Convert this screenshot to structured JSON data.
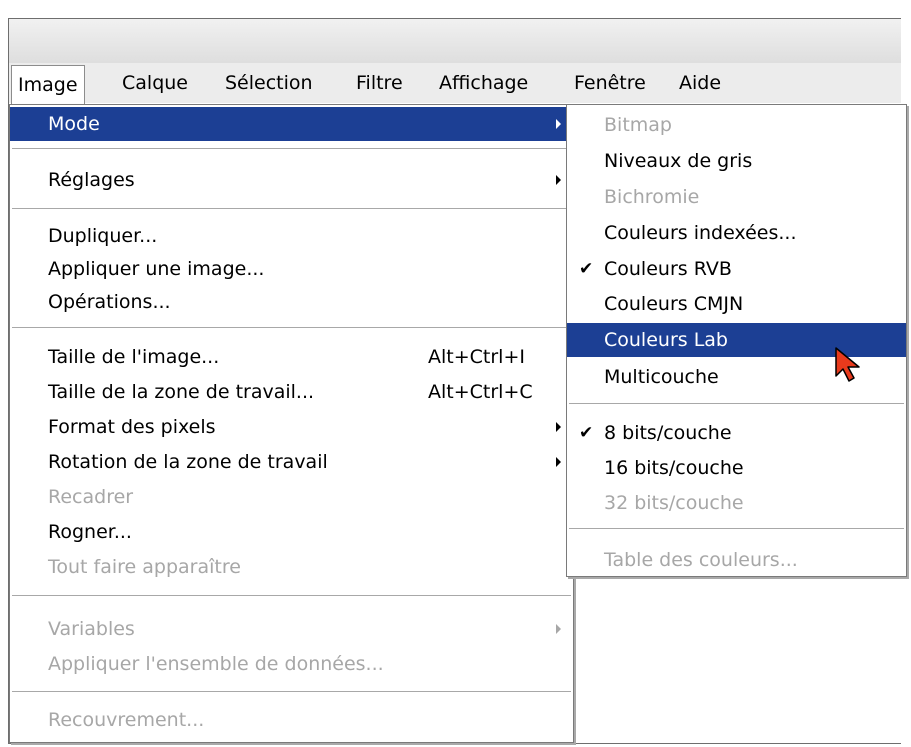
{
  "menubar": {
    "items": [
      "Image",
      "Calque",
      "Sélection",
      "Filtre",
      "Affichage",
      "Fenêtre",
      "Aide"
    ]
  },
  "image_menu": {
    "mode": "Mode",
    "reglages": "Réglages",
    "dupliquer": "Dupliquer...",
    "appliquer_image": "Appliquer une image...",
    "operations": "Opérations...",
    "taille_image": "Taille de l'image...",
    "taille_image_shortcut": "Alt+Ctrl+I",
    "taille_zone": "Taille de la zone de travail...",
    "taille_zone_shortcut": "Alt+Ctrl+C",
    "format_pixels": "Format des pixels",
    "rotation": "Rotation de la zone de travail",
    "recadrer": "Recadrer",
    "rogner": "Rogner...",
    "tout_faire": "Tout faire apparaître",
    "variables": "Variables",
    "appliquer_donnees": "Appliquer l'ensemble de données...",
    "recouvrement": "Recouvrement..."
  },
  "mode_submenu": {
    "bitmap": "Bitmap",
    "niveaux_gris": "Niveaux de gris",
    "bichromie": "Bichromie",
    "couleurs_indexees": "Couleurs indexées...",
    "couleurs_rvb": "Couleurs RVB",
    "couleurs_cmjn": "Couleurs CMJN",
    "couleurs_lab": "Couleurs Lab",
    "multicouche": "Multicouche",
    "bits8": "8 bits/couche",
    "bits16": "16 bits/couche",
    "bits32": "32 bits/couche",
    "table_couleurs": "Table des couleurs...",
    "checkmark": "✔"
  },
  "colors": {
    "highlight": "#1c3f94",
    "disabled_text": "#a7a7a7",
    "cursor": "#e83a1c"
  },
  "icons": {
    "cursor": "mouse-pointer-icon",
    "submenu": "chevron-right-icon",
    "check": "checkmark-icon"
  }
}
